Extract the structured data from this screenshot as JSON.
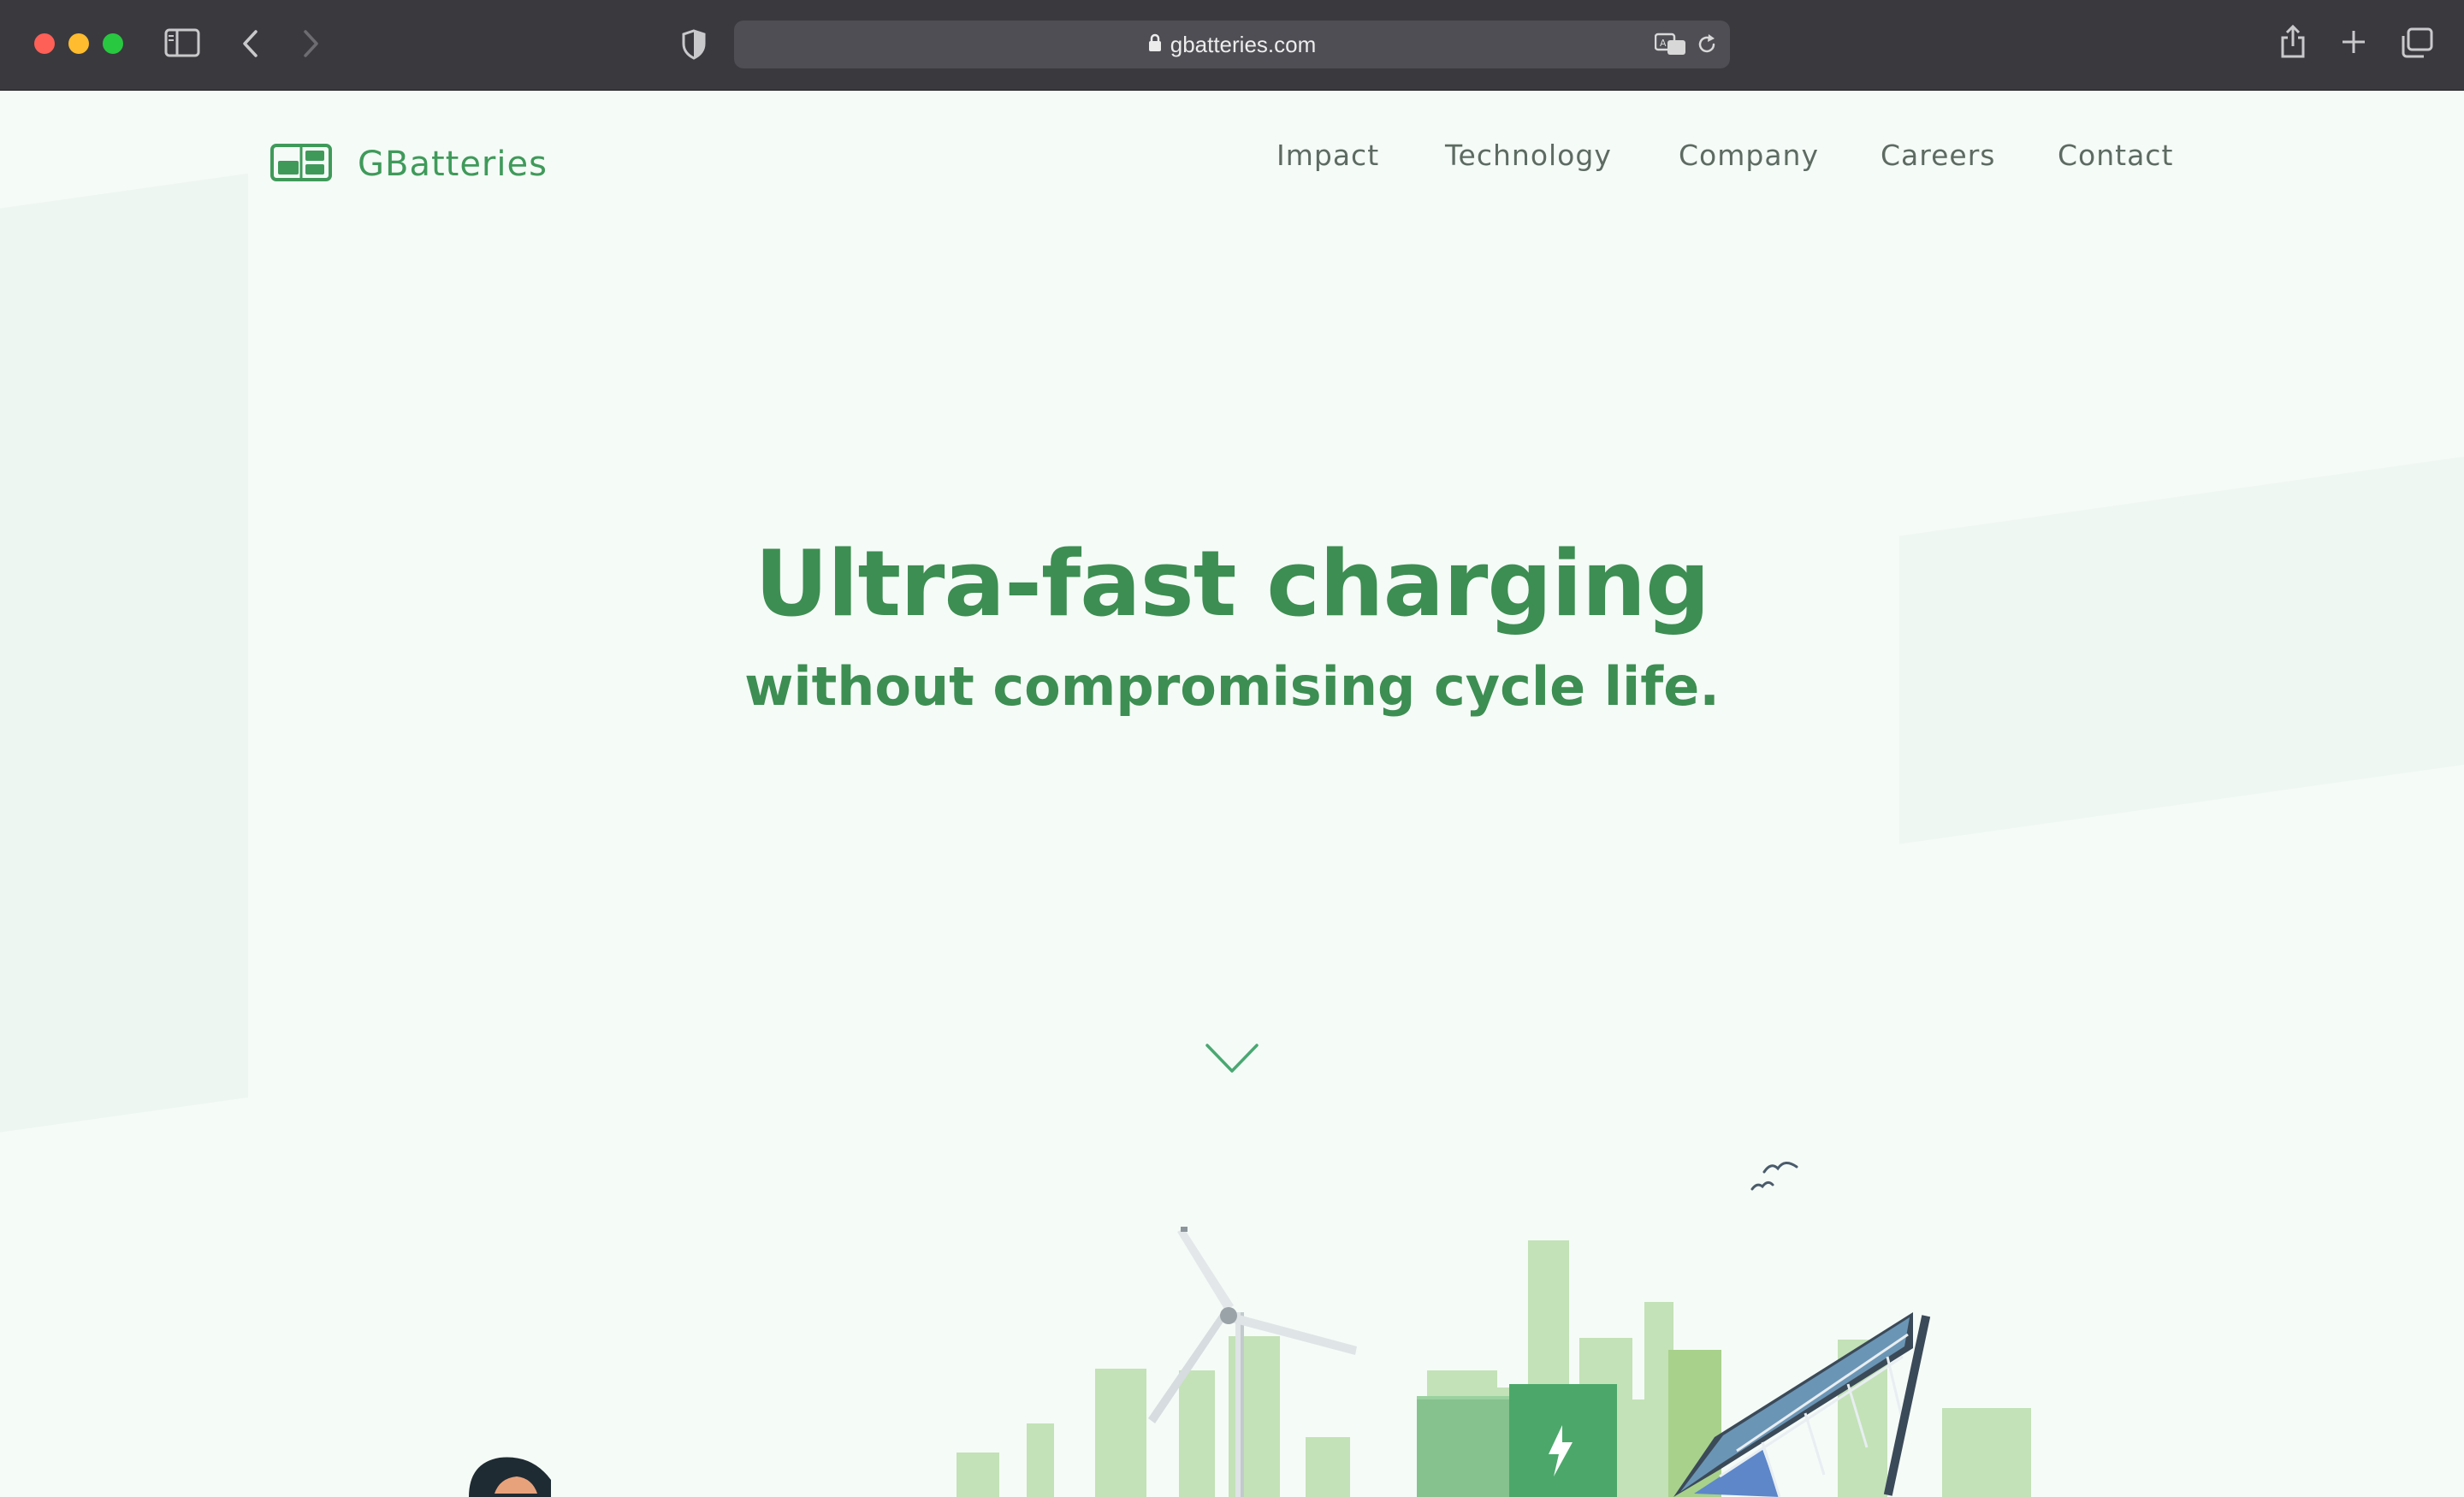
{
  "browser": {
    "url": "gbatteries.com",
    "icons": [
      "sidebar-icon",
      "back-icon",
      "forward-icon",
      "shield-icon",
      "lock-icon",
      "translate-icon",
      "reload-icon",
      "share-icon",
      "new-tab-icon",
      "tabs-overview-icon"
    ]
  },
  "header": {
    "logo_text": "GBatteries",
    "nav": [
      "Impact",
      "Technology",
      "Company",
      "Careers",
      "Contact"
    ]
  },
  "hero": {
    "title": "Ultra-fast charging",
    "subtitle": "without compromising cycle life.",
    "scroll_icon": "chevron-down-icon"
  },
  "colors": {
    "brand_green": "#3d8e52",
    "page_background": "#f5fbf7",
    "nav_text": "#5d6b63",
    "chrome_background": "#3a393e"
  }
}
